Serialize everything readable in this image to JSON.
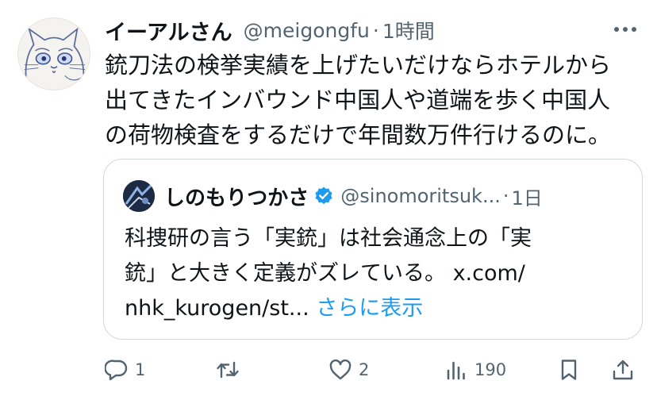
{
  "tweet": {
    "display_name": "イーアルさん",
    "handle": "@meigongfu",
    "separator": "·",
    "time": "1時間",
    "text": "銃刀法の検挙実績を上げたいだけならホテルから\n出てきたインバウンド中国人や道端を歩く中国人\nの荷物検査をするだけで年間数万件行けるのに。"
  },
  "quote": {
    "display_name": "しのもりつかさ",
    "handle": "@sinomoritsuk...",
    "separator": "·",
    "time": "1日",
    "text": "科捜研の言う「実銃」は社会通念上の「実\n銃」と大きく定義がズレている。 x.com/\nnhk_kurogen/st... ",
    "show_more": "さらに表示"
  },
  "actions": {
    "reply_count": "1",
    "retweet_count": "",
    "like_count": "2",
    "views_count": "190"
  },
  "icons": {
    "more": "more-horizontal-icon",
    "verified": "verified-badge-icon",
    "reply": "reply-icon",
    "retweet": "retweet-icon",
    "like": "heart-icon",
    "views": "views-icon",
    "bookmark": "bookmark-icon",
    "share": "share-icon"
  },
  "colors": {
    "text": "#0f1419",
    "secondary": "#536471",
    "accent": "#1d9bf0",
    "border": "#cfd9de"
  }
}
